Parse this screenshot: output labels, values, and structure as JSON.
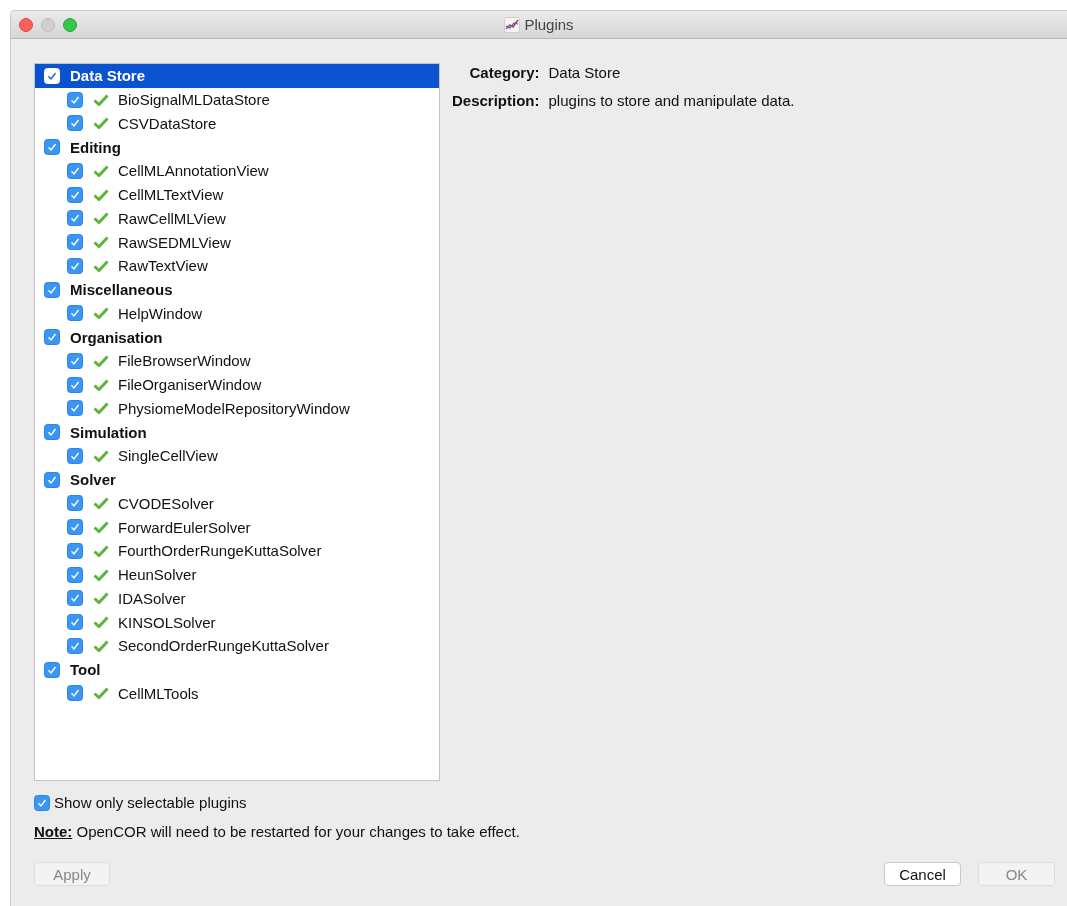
{
  "window": {
    "title": "Plugins"
  },
  "tree": [
    {
      "label": "Data Store",
      "checked": true,
      "selected": true,
      "children": [
        {
          "label": "BioSignalMLDataStore",
          "checked": true
        },
        {
          "label": "CSVDataStore",
          "checked": true
        }
      ]
    },
    {
      "label": "Editing",
      "checked": true,
      "selected": false,
      "children": [
        {
          "label": "CellMLAnnotationView",
          "checked": true
        },
        {
          "label": "CellMLTextView",
          "checked": true
        },
        {
          "label": "RawCellMLView",
          "checked": true
        },
        {
          "label": "RawSEDMLView",
          "checked": true
        },
        {
          "label": "RawTextView",
          "checked": true
        }
      ]
    },
    {
      "label": "Miscellaneous",
      "checked": true,
      "selected": false,
      "children": [
        {
          "label": "HelpWindow",
          "checked": true
        }
      ]
    },
    {
      "label": "Organisation",
      "checked": true,
      "selected": false,
      "children": [
        {
          "label": "FileBrowserWindow",
          "checked": true
        },
        {
          "label": "FileOrganiserWindow",
          "checked": true
        },
        {
          "label": "PhysiomeModelRepositoryWindow",
          "checked": true
        }
      ]
    },
    {
      "label": "Simulation",
      "checked": true,
      "selected": false,
      "children": [
        {
          "label": "SingleCellView",
          "checked": true
        }
      ]
    },
    {
      "label": "Solver",
      "checked": true,
      "selected": false,
      "children": [
        {
          "label": "CVODESolver",
          "checked": true
        },
        {
          "label": "ForwardEulerSolver",
          "checked": true
        },
        {
          "label": "FourthOrderRungeKuttaSolver",
          "checked": true
        },
        {
          "label": "HeunSolver",
          "checked": true
        },
        {
          "label": "IDASolver",
          "checked": true
        },
        {
          "label": "KINSOLSolver",
          "checked": true
        },
        {
          "label": "SecondOrderRungeKuttaSolver",
          "checked": true
        }
      ]
    },
    {
      "label": "Tool",
      "checked": true,
      "selected": false,
      "children": [
        {
          "label": "CellMLTools",
          "checked": true
        }
      ]
    }
  ],
  "details": [
    {
      "label": "Category:",
      "value": "Data Store"
    },
    {
      "label": "Description:",
      "value": "plugins to store and manipulate data."
    }
  ],
  "show_only_selectable": {
    "label": "Show only selectable plugins",
    "checked": true
  },
  "note": "**Note:** OpenCOR will need to be restarted for your changes to take effect.",
  "buttons": [
    {
      "label": "Apply",
      "disabled": true
    },
    {
      "label": "Cancel",
      "disabled": false
    },
    {
      "label": "OK",
      "disabled": true
    }
  ]
}
